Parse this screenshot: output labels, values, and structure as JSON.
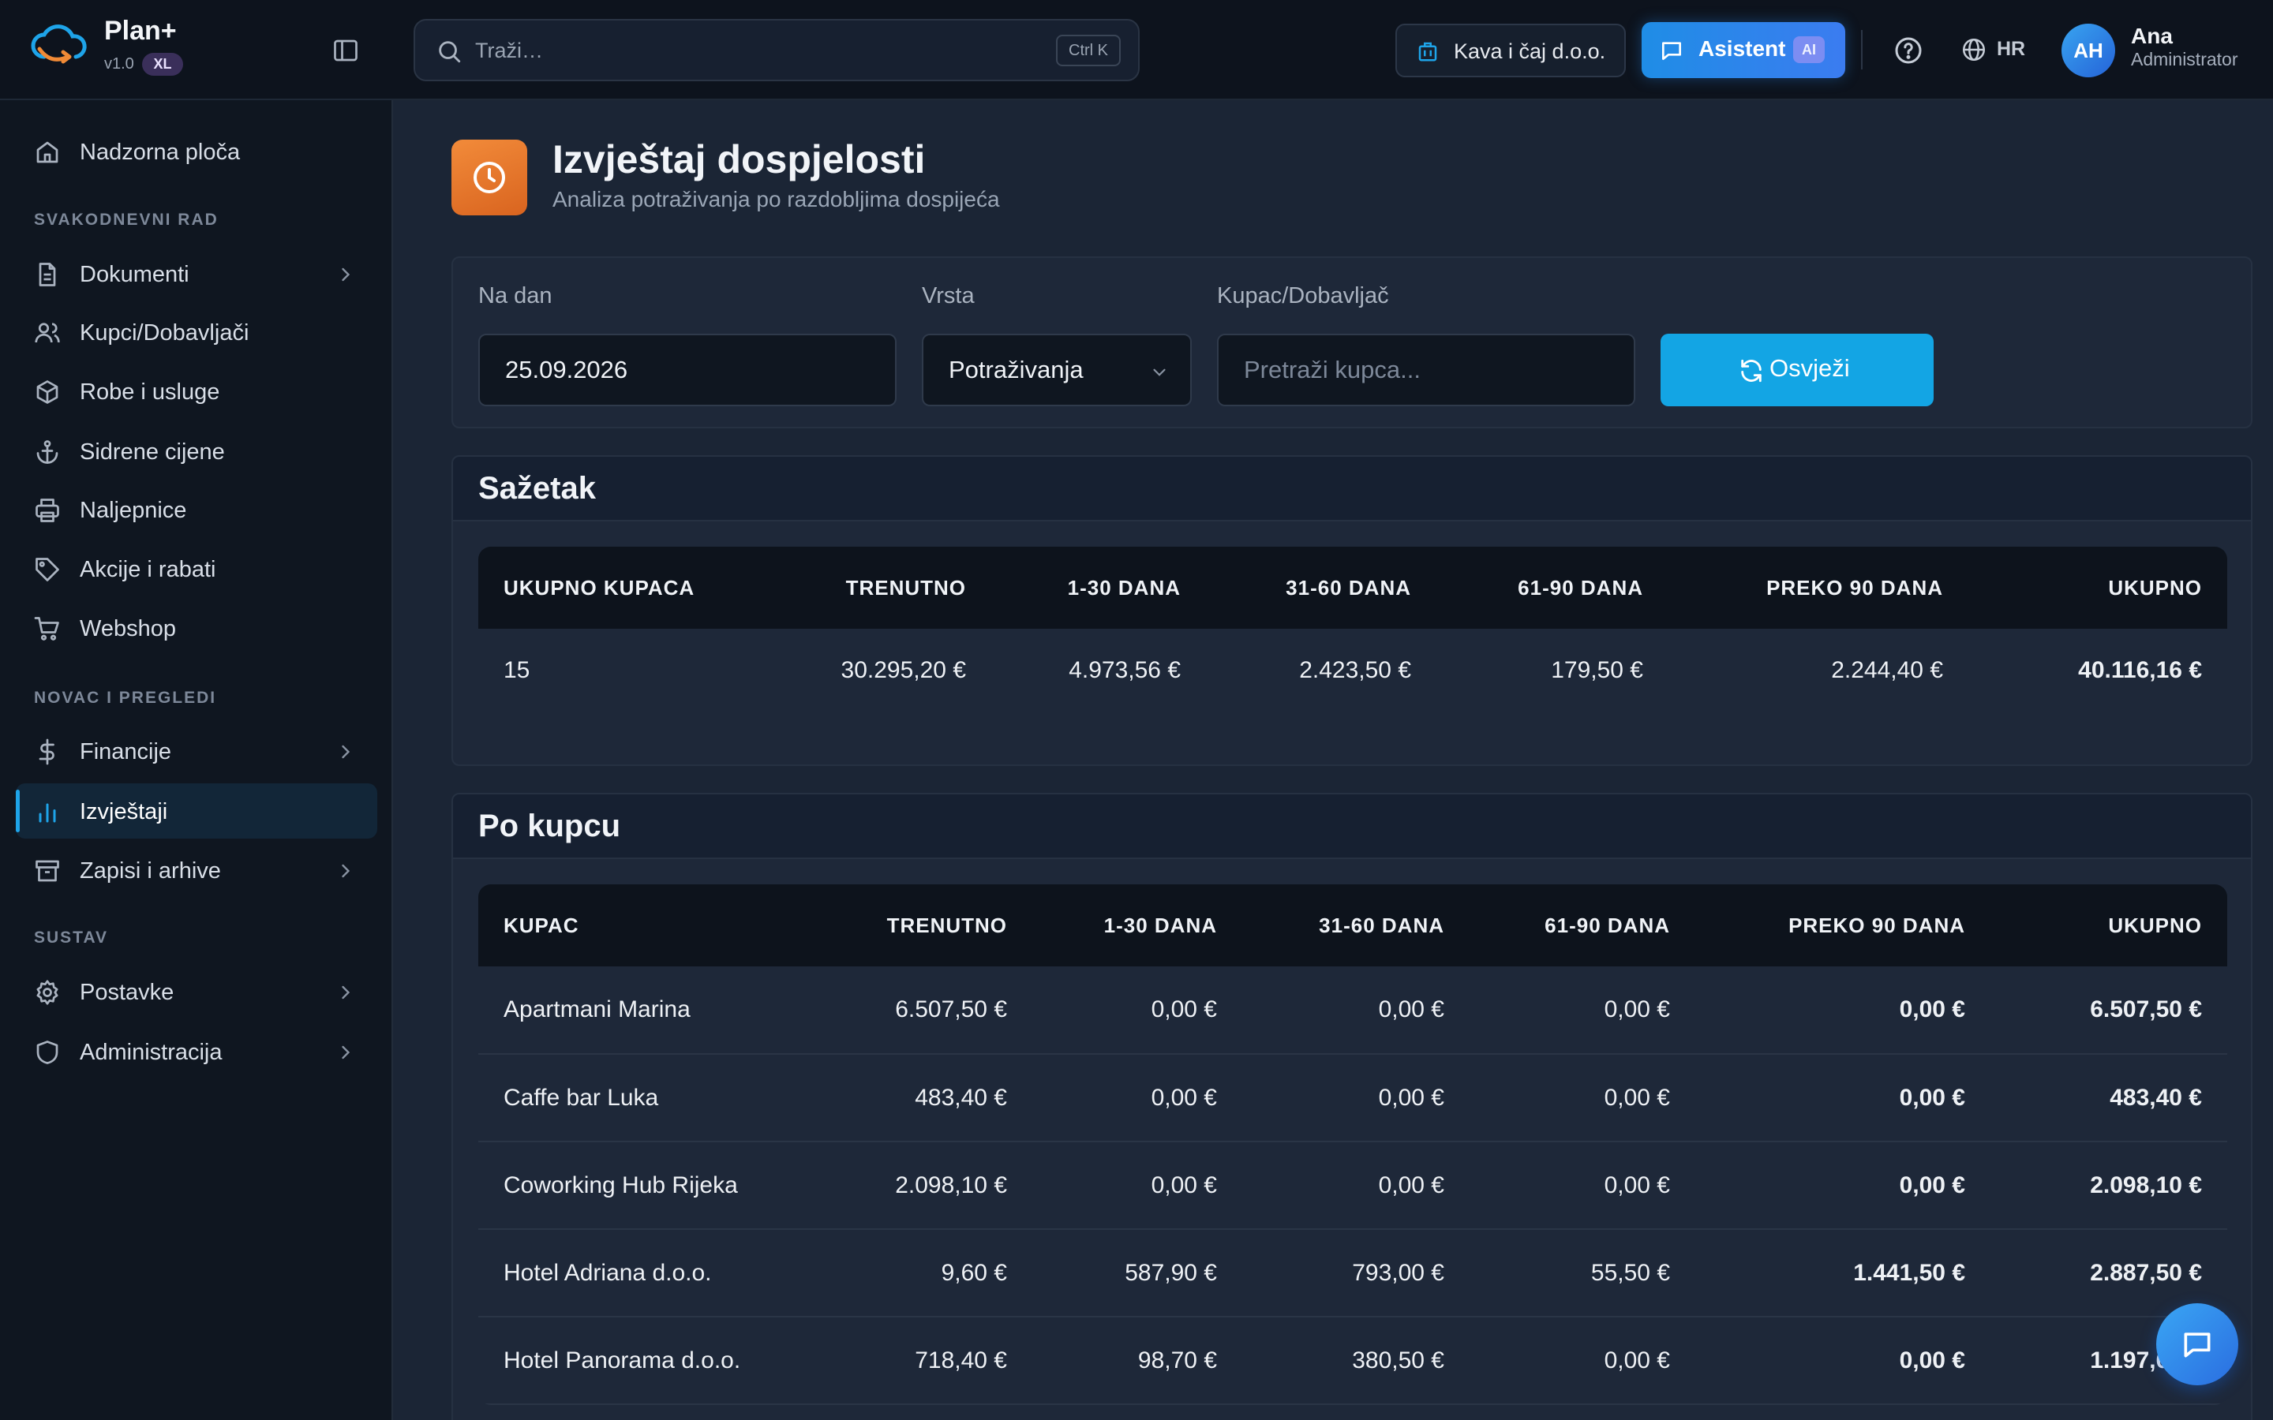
{
  "brand": {
    "name": "Plan+",
    "version": "v1.0",
    "badge": "XL"
  },
  "search": {
    "placeholder": "Traži…",
    "shortcut": "Ctrl K"
  },
  "header": {
    "company": "Kava i čaj d.o.o.",
    "assistant_label": "Asistent",
    "assistant_badge": "AI",
    "language": "HR",
    "user": {
      "initials": "AH",
      "name": "Ana",
      "role": "Administrator"
    }
  },
  "sidebar": {
    "dashboard": "Nadzorna ploča",
    "sections": {
      "daily": "SVAKODNEVNI RAD",
      "money": "NOVAC I PREGLEDI",
      "system": "SUSTAV"
    },
    "items": {
      "documents": "Dokumenti",
      "partners": "Kupci/Dobavljači",
      "goods": "Robe i usluge",
      "anchor_prices": "Sidrene cijene",
      "labels": "Naljepnice",
      "promotions": "Akcije i rabati",
      "webshop": "Webshop",
      "finance": "Financije",
      "reports": "Izvještaji",
      "records": "Zapisi i arhive",
      "settings": "Postavke",
      "administration": "Administracija"
    }
  },
  "page": {
    "title": "Izvještaj dospjelosti",
    "subtitle": "Analiza potraživanja po razdobljima dospijeća"
  },
  "filters": {
    "date_label": "Na dan",
    "date_value": "25.09.2026",
    "type_label": "Vrsta",
    "type_value": "Potraživanja",
    "partner_label": "Kupac/Dobavljač",
    "partner_placeholder": "Pretraži kupca...",
    "refresh_label": "Osvježi"
  },
  "summary": {
    "title": "Sažetak",
    "headers": [
      "UKUPNO KUPACA",
      "TRENUTNO",
      "1-30 DANA",
      "31-60 DANA",
      "61-90 DANA",
      "PREKO 90 DANA",
      "UKUPNO"
    ],
    "row": [
      "15",
      "30.295,20 €",
      "4.973,56 €",
      "2.423,50 €",
      "179,50 €",
      "2.244,40 €",
      "40.116,16 €"
    ]
  },
  "by_customer": {
    "title": "Po kupcu",
    "headers": [
      "KUPAC",
      "TRENUTNO",
      "1-30 DANA",
      "31-60 DANA",
      "61-90 DANA",
      "PREKO 90 DANA",
      "UKUPNO"
    ],
    "rows": [
      [
        "Apartmani Marina",
        "6.507,50 €",
        "0,00 €",
        "0,00 €",
        "0,00 €",
        "0,00 €",
        "6.507,50 €"
      ],
      [
        "Caffe bar Luka",
        "483,40 €",
        "0,00 €",
        "0,00 €",
        "0,00 €",
        "0,00 €",
        "483,40 €"
      ],
      [
        "Coworking Hub Rijeka",
        "2.098,10 €",
        "0,00 €",
        "0,00 €",
        "0,00 €",
        "0,00 €",
        "2.098,10 €"
      ],
      [
        "Hotel Adriana d.o.o.",
        "9,60 €",
        "587,90 €",
        "793,00 €",
        "55,50 €",
        "1.441,50 €",
        "2.887,50 €"
      ],
      [
        "Hotel Panorama d.o.o.",
        "718,40 €",
        "98,70 €",
        "380,50 €",
        "0,00 €",
        "0,00 €",
        "1.197,60 €"
      ]
    ]
  },
  "colors": {
    "accent": "#13a5e4",
    "page_icon": "#e8782c",
    "assistant": "#2a86ea",
    "background": "#1b2535",
    "sidebar": "#0f1620"
  }
}
